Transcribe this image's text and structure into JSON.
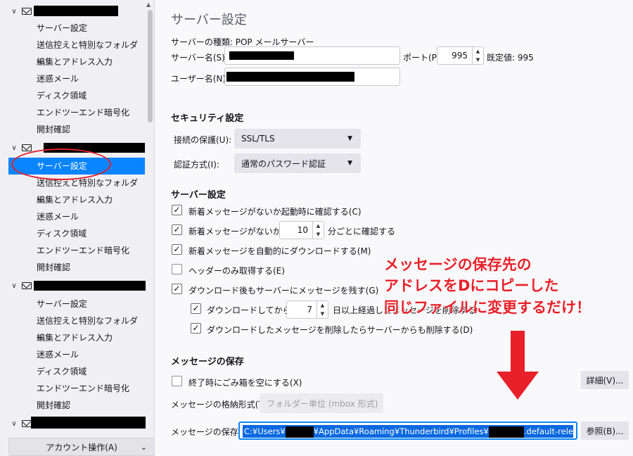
{
  "sidebar": {
    "accounts": [
      {
        "items": [
          "サーバー設定",
          "送信控えと特別なフォルダー",
          "編集とアドレス入力",
          "迷惑メール",
          "ディスク領域",
          "エンドツーエンド暗号化",
          "開封確認"
        ]
      },
      {
        "items": [
          "サーバー設定",
          "送信控えと特別なフォルダー",
          "編集とアドレス入力",
          "迷惑メール",
          "ディスク領域",
          "エンドツーエンド暗号化",
          "開封確認"
        ]
      },
      {
        "items": [
          "サーバー設定",
          "送信控えと特別なフォルダー",
          "編集とアドレス入力",
          "迷惑メール",
          "ディスク領域",
          "エンドツーエンド暗号化",
          "開封確認"
        ]
      }
    ],
    "account_actions": "アカウント操作(A)"
  },
  "main": {
    "title": "サーバー設定",
    "server_type": "サーバーの種類: POP メールサーバー",
    "server_name_label": "サーバー名(S):",
    "port_label": "ポート(P):",
    "port_value": "995",
    "port_default": "既定値: 995",
    "username_label": "ユーザー名(N):",
    "security": {
      "heading": "セキュリティ設定",
      "conn_label": "接続の保護(U):",
      "conn_value": "SSL/TLS",
      "auth_label": "認証方式(I):",
      "auth_value": "通常のパスワード認証"
    },
    "server_settings": {
      "heading": "サーバー設定",
      "opt1": "新着メッセージがないか起動時に確認する(C)",
      "opt2_pre": "新着メッセージがないか(Y)",
      "opt2_value": "10",
      "opt2_post": "分ごとに確認する",
      "opt3": "新着メッセージを自動的にダウンロードする(M)",
      "opt4": "ヘッダーのみ取得する(E)",
      "opt5": "ダウンロード後もサーバーにメッセージを残す(G)",
      "opt6_pre": "ダウンロードしてから(O)",
      "opt6_value": "7",
      "opt6_post": "日以上経過したメッセージを削除する",
      "opt7": "ダウンロードしたメッセージを削除したらサーバーからも削除する(D)"
    },
    "storage": {
      "heading": "メッセージの保存",
      "empty_trash": "終了時にごみ箱を空にする(X)",
      "details_button": "詳細(V)...",
      "format_label": "メッセージの格納形式(T):",
      "format_value": "フォルダー単位 (mbox 形式)",
      "path_label": "メッセージの保存先:",
      "path_p1": "C:¥Users¥",
      "path_p2": "¥AppData¥Roaming¥Thunderbird¥Profiles¥",
      "path_p3": ".default-release",
      "browse_button": "参照(B)..."
    }
  },
  "annotation": {
    "line1": "メッセージの保存先の",
    "line2": "アドレスをDにコピーした",
    "line3": "同じファイルに変更するだけ！",
    "color": "#e8202a"
  }
}
